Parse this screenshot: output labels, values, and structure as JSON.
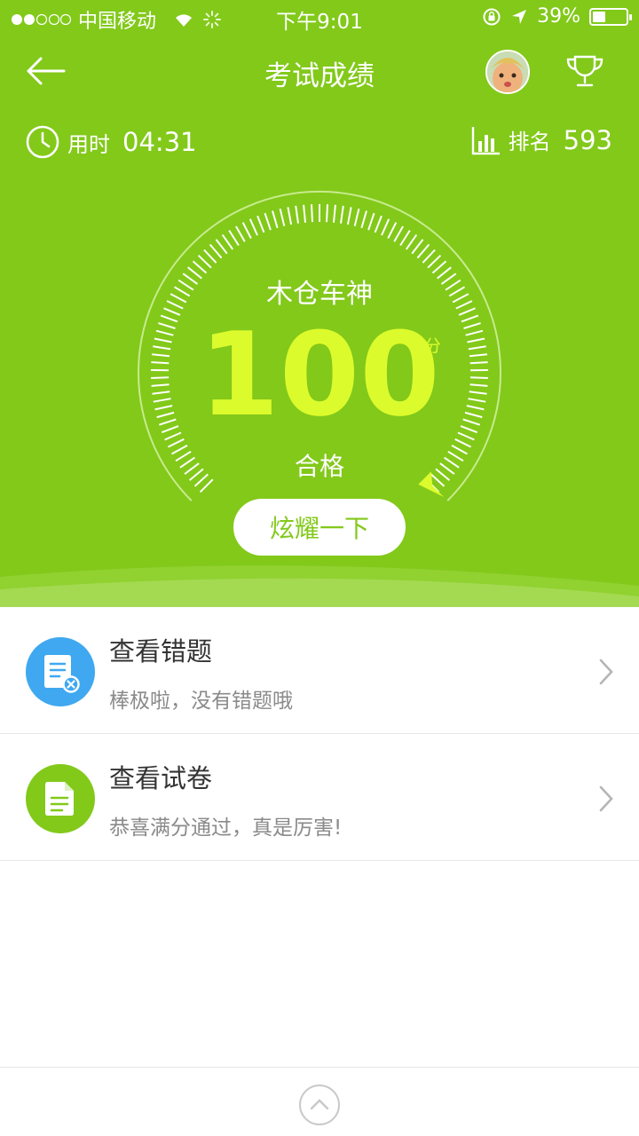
{
  "status_bar": {
    "carrier": "中国移动",
    "time": "下午9:01",
    "battery": "39%",
    "battery_level": 0.39,
    "signal_bars_filled": 2,
    "signal_bars_total": 5
  },
  "header": {
    "title": "考试成绩",
    "back_icon": "back-arrow-icon",
    "trophy_icon": "trophy-icon"
  },
  "stats": {
    "time_label": "用时",
    "time_value": "04:31",
    "rank_label": "排名",
    "rank_value": "593"
  },
  "result": {
    "title": "木仓车神",
    "score": "100",
    "unit": "分",
    "status": "合格",
    "share_label": "炫耀一下"
  },
  "items": [
    {
      "title": "查看错题",
      "subtitle": "棒极啦，没有错题哦",
      "icon": "wrong-questions-icon",
      "color": "#3fa8f0"
    },
    {
      "title": "查看试卷",
      "subtitle": "恭喜满分通过，真是厉害!",
      "icon": "exam-paper-icon",
      "color": "#82c91a"
    }
  ],
  "colors": {
    "primary_green": "#82c91a",
    "score_yellow": "#dcfb2c",
    "blue": "#3fa8f0"
  }
}
